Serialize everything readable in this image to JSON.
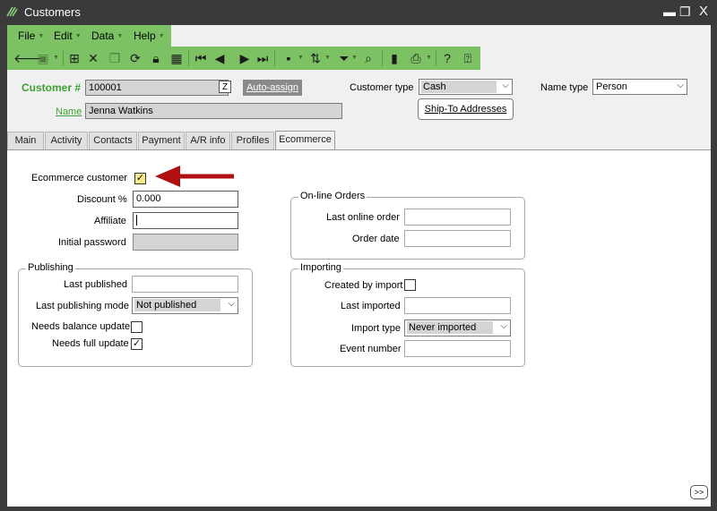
{
  "window": {
    "title": "Customers",
    "minimize": "▬",
    "restore": "❐",
    "close": "X"
  },
  "menu": {
    "file": "File",
    "edit": "Edit",
    "data": "Data",
    "help": "Help"
  },
  "header": {
    "customer_label": "Customer #",
    "customer_value": "100001",
    "lookup": "Z",
    "auto_assign": "Auto-assign",
    "name_label": "Name",
    "name_value": "Jenna Watkins",
    "customer_type_label": "Customer type",
    "customer_type_value": "Cash",
    "ship_to": "Ship-To Addresses",
    "name_type_label": "Name type",
    "name_type_value": "Person"
  },
  "tabs": [
    "Main",
    "Activity",
    "Contacts",
    "Payment",
    "A/R info",
    "Profiles",
    "Ecommerce"
  ],
  "ecommerce": {
    "ecommerce_customer_label": "Ecommerce customer",
    "ecommerce_customer_checked": "✓",
    "discount_label": "Discount %",
    "discount_value": "0.000",
    "affiliate_label": "Affiliate",
    "affiliate_value": "",
    "initial_password_label": "Initial password",
    "initial_password_value": ""
  },
  "publishing": {
    "title": "Publishing",
    "last_published_label": "Last published",
    "last_published_value": "",
    "last_publishing_mode_label": "Last publishing mode",
    "last_publishing_mode_value": "Not published",
    "needs_balance_update_label": "Needs balance update",
    "needs_full_update_label": "Needs full update",
    "needs_full_update_checked": "✓"
  },
  "online_orders": {
    "title": "On-line Orders",
    "last_online_order_label": "Last online order",
    "order_date_label": "Order date"
  },
  "importing": {
    "title": "Importing",
    "created_by_import_label": "Created by import",
    "last_imported_label": "Last imported",
    "import_type_label": "Import type",
    "import_type_value": "Never imported",
    "event_number_label": "Event number"
  },
  "footer": {
    "expand": ">>"
  },
  "colors": {
    "accent_green": "#7cc264",
    "label_green": "#3da035",
    "arrow_red": "#b01010"
  }
}
